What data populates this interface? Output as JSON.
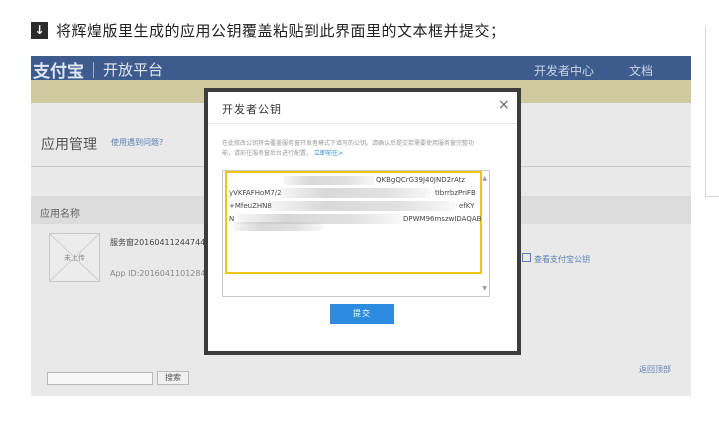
{
  "instruction": {
    "icon": "down-arrow-icon",
    "text": "将辉煌版里生成的应用公钥覆盖粘贴到此界面里的文本框并提交；"
  },
  "site": {
    "logo": "支付宝",
    "platform": "开放平台",
    "header_links": [
      "开发者中心",
      "文档"
    ],
    "page_title": "应用管理",
    "help_link": "使用遇到问题?",
    "table_column": "应用名称",
    "app": {
      "thumb_label": "未上传",
      "name": "服务窗20160411244744585",
      "app_id": "App ID:2016041101284703"
    },
    "view_key_link": "查看支付宝公钥",
    "search_button": "搜索",
    "jump_link": "返回顶部"
  },
  "modal": {
    "title": "开发者公钥",
    "close_icon": "close-icon",
    "description": "在此修改公钥将会覆盖服务窗开发者模式下填写的公钥。请确认后提交若需要使用服务窗完整功能，请前往服务窗后台进行配置。",
    "description_link": "立即前往>",
    "key_lines": [
      "QKBgQCrG39J40JND2rAtz",
      "yVKFAFHoM7/2",
      "tIbrrbzPriFB",
      "+MfeuZHN8",
      "efKY",
      "N",
      "DPWM96mszwIDAQAB"
    ],
    "submit_label": "提交"
  }
}
